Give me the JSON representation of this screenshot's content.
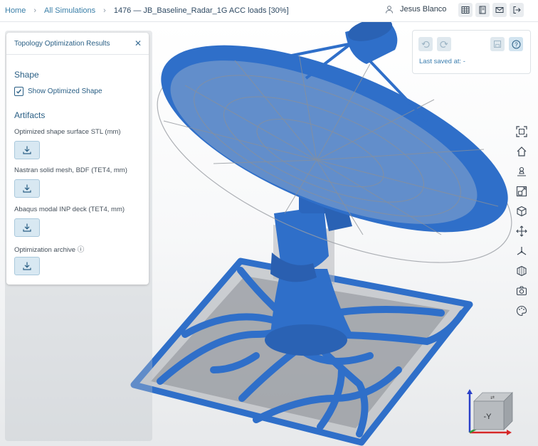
{
  "breadcrumb": {
    "home": "Home",
    "all_simulations": "All Simulations",
    "current": "1476 — JB_Baseline_Radar_1G ACC loads [30%]"
  },
  "user": {
    "name": "Jesus Blanco",
    "icon": "user-icon"
  },
  "toolbar_icons": [
    "table-icon",
    "notebook-icon",
    "mail-icon",
    "logout-icon"
  ],
  "panel": {
    "title": "Topology Optimization Results",
    "shape_section": "Shape",
    "show_optimized_shape": "Show Optimized Shape",
    "show_optimized_shape_checked": true,
    "artifacts_section": "Artifacts",
    "artifacts": [
      {
        "label": "Optimized shape surface STL (mm)"
      },
      {
        "label": "Nastran solid mesh, BDF (TET4, mm)"
      },
      {
        "label": "Abaqus modal INP deck (TET4, mm)"
      },
      {
        "label": "Optimization archive ⓘ"
      }
    ]
  },
  "save_panel": {
    "last_saved": "Last saved at: -"
  },
  "right_tools": [
    "fit-view-icon",
    "home-icon",
    "pin-icon",
    "zoom-box-icon",
    "cube-icon",
    "move-icon",
    "axes-icon",
    "section-cube-icon",
    "camera-icon",
    "palette-icon"
  ],
  "view_cube": {
    "face_label": "-Y"
  },
  "colors": {
    "model_blue": "#2f6fc9",
    "accent": "#2a5f85",
    "link": "#3a7fa8"
  }
}
